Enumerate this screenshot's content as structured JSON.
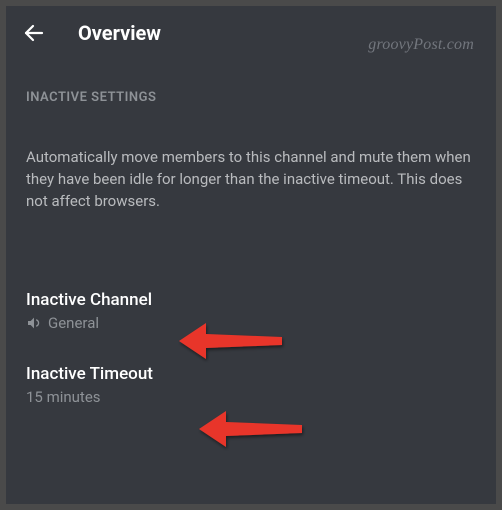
{
  "header": {
    "title": "Overview"
  },
  "watermark": "groovyPost.com",
  "section": {
    "title": "INACTIVE SETTINGS",
    "description": "Automatically move members to this channel and mute them when they have been idle for longer than the inactive timeout. This does not affect browsers."
  },
  "rows": {
    "inactive_channel": {
      "label": "Inactive Channel",
      "value": "General"
    },
    "inactive_timeout": {
      "label": "Inactive Timeout",
      "value": "15 minutes"
    }
  }
}
